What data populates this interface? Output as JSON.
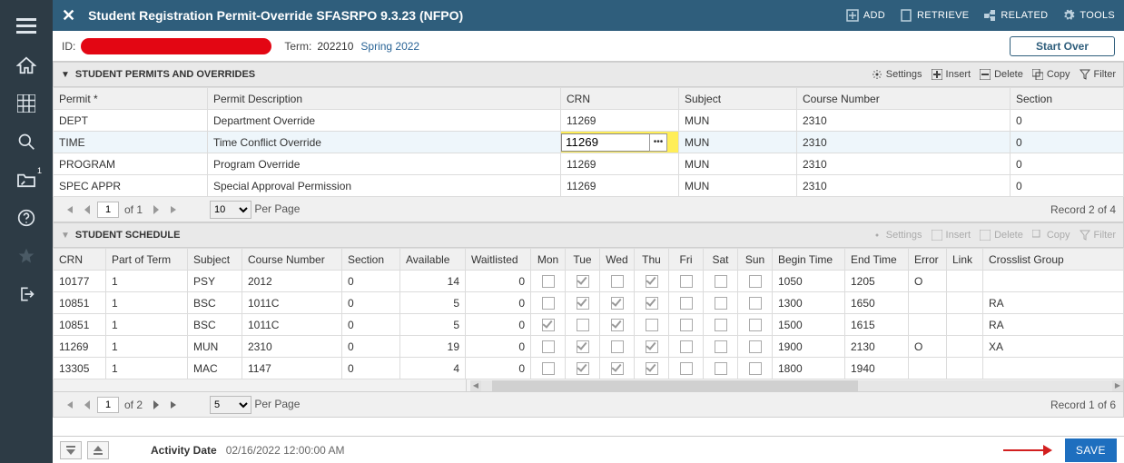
{
  "topbar": {
    "title": "Student Registration Permit-Override SFASRPO 9.3.23 (NFPO)",
    "add": "ADD",
    "retrieve": "RETRIEVE",
    "related": "RELATED",
    "tools": "TOOLS"
  },
  "keybar": {
    "id_label": "ID:",
    "term_label": "Term:",
    "term_value": "202210",
    "term_desc": "Spring 2022",
    "start_over": "Start Over"
  },
  "permits": {
    "section_title": "STUDENT PERMITS AND OVERRIDES",
    "tools": {
      "settings": "Settings",
      "insert": "Insert",
      "delete": "Delete",
      "copy": "Copy",
      "filter": "Filter"
    },
    "cols": {
      "permit": "Permit *",
      "desc": "Permit Description",
      "crn": "CRN",
      "subject": "Subject",
      "course": "Course Number",
      "section": "Section"
    },
    "rows": [
      {
        "permit": "DEPT",
        "desc": "Department Override",
        "crn": "11269",
        "subject": "MUN",
        "course": "2310",
        "section": "0"
      },
      {
        "permit": "TIME",
        "desc": "Time Conflict Override",
        "crn": "11269",
        "subject": "MUN",
        "course": "2310",
        "section": "0"
      },
      {
        "permit": "PROGRAM",
        "desc": "Program Override",
        "crn": "11269",
        "subject": "MUN",
        "course": "2310",
        "section": "0"
      },
      {
        "permit": "SPEC APPR",
        "desc": "Special Approval Permission",
        "crn": "11269",
        "subject": "MUN",
        "course": "2310",
        "section": "0"
      }
    ],
    "pager": {
      "page": "1",
      "of": "of 1",
      "perpage": "10",
      "perpage_label": "Per Page",
      "record": "Record 2 of 4"
    }
  },
  "schedule": {
    "section_title": "STUDENT SCHEDULE",
    "tools": {
      "settings": "Settings",
      "insert": "Insert",
      "delete": "Delete",
      "copy": "Copy",
      "filter": "Filter"
    },
    "cols": {
      "crn": "CRN",
      "pot": "Part of Term",
      "subject": "Subject",
      "course": "Course Number",
      "section": "Section",
      "avail": "Available",
      "wait": "Waitlisted",
      "mon": "Mon",
      "tue": "Tue",
      "wed": "Wed",
      "thu": "Thu",
      "fri": "Fri",
      "sat": "Sat",
      "sun": "Sun",
      "begin": "Begin Time",
      "end": "End Time",
      "error": "Error",
      "link": "Link",
      "crosslist": "Crosslist Group"
    },
    "rows": [
      {
        "crn": "10177",
        "pot": "1",
        "subject": "PSY",
        "course": "2012",
        "section": "0",
        "avail": "14",
        "wait": "0",
        "days": [
          false,
          true,
          false,
          true,
          false,
          false,
          false
        ],
        "begin": "1050",
        "end": "1205",
        "error": "O",
        "link": "",
        "cl": ""
      },
      {
        "crn": "10851",
        "pot": "1",
        "subject": "BSC",
        "course": "1011C",
        "section": "0",
        "avail": "5",
        "wait": "0",
        "days": [
          false,
          true,
          true,
          true,
          false,
          false,
          false
        ],
        "begin": "1300",
        "end": "1650",
        "error": "",
        "link": "",
        "cl": "RA"
      },
      {
        "crn": "10851",
        "pot": "1",
        "subject": "BSC",
        "course": "1011C",
        "section": "0",
        "avail": "5",
        "wait": "0",
        "days": [
          true,
          false,
          true,
          false,
          false,
          false,
          false
        ],
        "begin": "1500",
        "end": "1615",
        "error": "",
        "link": "",
        "cl": "RA"
      },
      {
        "crn": "11269",
        "pot": "1",
        "subject": "MUN",
        "course": "2310",
        "section": "0",
        "avail": "19",
        "wait": "0",
        "days": [
          false,
          true,
          false,
          true,
          false,
          false,
          false
        ],
        "begin": "1900",
        "end": "2130",
        "error": "O",
        "link": "",
        "cl": "XA"
      },
      {
        "crn": "13305",
        "pot": "1",
        "subject": "MAC",
        "course": "1147",
        "section": "0",
        "avail": "4",
        "wait": "0",
        "days": [
          false,
          true,
          true,
          true,
          false,
          false,
          false
        ],
        "begin": "1800",
        "end": "1940",
        "error": "",
        "link": "",
        "cl": ""
      }
    ],
    "pager": {
      "page": "1",
      "of": "of 2",
      "perpage": "5",
      "perpage_label": "Per Page",
      "record": "Record 1 of 6"
    }
  },
  "footer": {
    "activity_label": "Activity Date",
    "activity_value": "02/16/2022 12:00:00 AM",
    "save": "SAVE"
  }
}
